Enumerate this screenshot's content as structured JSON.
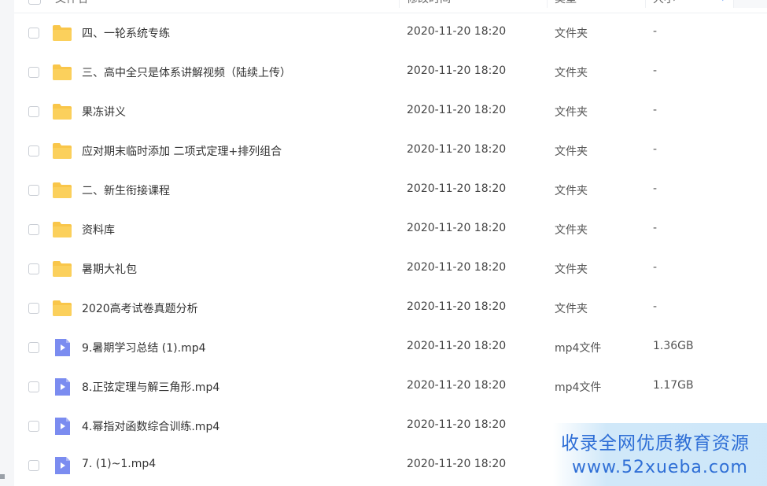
{
  "header": {
    "name_label": "文件名",
    "time_label": "修改时间",
    "type_label": "类型",
    "size_label": "大小"
  },
  "rows": [
    {
      "name": "四、一轮系统专练",
      "time": "2020-11-20 18:20",
      "type": "文件夹",
      "size": "-",
      "icon": "folder-icon"
    },
    {
      "name": "三、高中全只是体系讲解视频（陆续上传）",
      "time": "2020-11-20 18:20",
      "type": "文件夹",
      "size": "-",
      "icon": "folder-icon"
    },
    {
      "name": "果冻讲义",
      "time": "2020-11-20 18:20",
      "type": "文件夹",
      "size": "-",
      "icon": "folder-icon"
    },
    {
      "name": "应对期末临时添加 二项式定理+排列组合",
      "time": "2020-11-20 18:20",
      "type": "文件夹",
      "size": "-",
      "icon": "folder-icon"
    },
    {
      "name": "二、新生衔接课程",
      "time": "2020-11-20 18:20",
      "type": "文件夹",
      "size": "-",
      "icon": "folder-icon"
    },
    {
      "name": "资料库",
      "time": "2020-11-20 18:20",
      "type": "文件夹",
      "size": "-",
      "icon": "folder-icon"
    },
    {
      "name": "暑期大礼包",
      "time": "2020-11-20 18:20",
      "type": "文件夹",
      "size": "-",
      "icon": "folder-icon"
    },
    {
      "name": "2020高考试卷真题分析",
      "time": "2020-11-20 18:20",
      "type": "文件夹",
      "size": "-",
      "icon": "folder-icon"
    },
    {
      "name": "9.暑期学习总结 (1).mp4",
      "time": "2020-11-20 18:20",
      "type": "mp4文件",
      "size": "1.36GB",
      "icon": "video-file-icon"
    },
    {
      "name": "8.正弦定理与解三角形.mp4",
      "time": "2020-11-20 18:20",
      "type": "mp4文件",
      "size": "1.17GB",
      "icon": "video-file-icon"
    },
    {
      "name": "4.幂指对函数综合训练.mp4",
      "time": "2020-11-20 18:20",
      "type": "",
      "size": "",
      "icon": "video-file-icon"
    },
    {
      "name": "7. (1)~1.mp4",
      "time": "2020-11-20 18:20",
      "type": "",
      "size": "",
      "icon": "video-file-icon"
    }
  ],
  "watermark": {
    "line1": "收录全网优质教育资源",
    "line2": "www.52xueba.com"
  },
  "colors": {
    "folder": "#f9c64a",
    "video": "#7b8cf0",
    "accent": "#2f6fd6"
  }
}
